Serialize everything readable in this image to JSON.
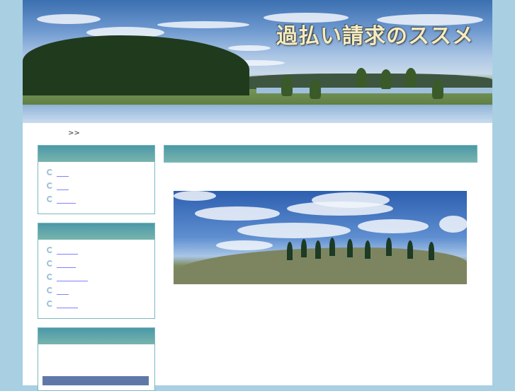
{
  "header": {
    "title": "過払い請求のススメ"
  },
  "breadcrumb": {
    "separator": ">>"
  },
  "sidebar": {
    "box1": {
      "links": [
        "",
        "",
        ""
      ]
    },
    "box2": {
      "links": [
        "",
        "",
        "",
        "",
        ""
      ]
    }
  }
}
